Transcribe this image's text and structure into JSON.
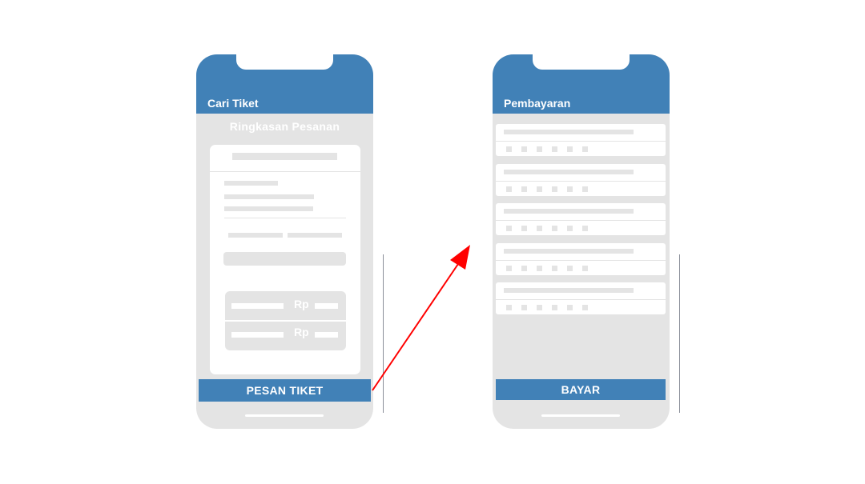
{
  "screens": {
    "search": {
      "title": "Cari Tiket",
      "summary_heading": "Ringkasan Pesanan",
      "price_rows": [
        {
          "currency": "Rp"
        },
        {
          "currency": "Rp"
        }
      ],
      "action_label": "PESAN TIKET"
    },
    "payment": {
      "title": "Pembayaran",
      "option_count": 5,
      "action_label": "BAYAR"
    }
  },
  "colors": {
    "header": "#4181b7",
    "screen_bg": "#e4e4e4",
    "arrow": "#ff0000"
  },
  "connector": {
    "from": "PESAN TIKET",
    "to": "Pembayaran"
  }
}
